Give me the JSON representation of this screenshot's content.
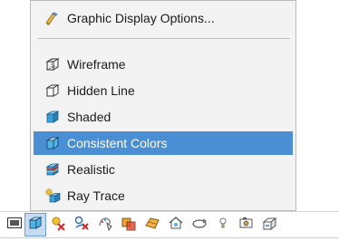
{
  "menu": {
    "items": [
      {
        "label": "Graphic Display Options...",
        "icon": "graphic-options-icon"
      },
      {
        "label": "Wireframe",
        "icon": "wireframe-cube-icon"
      },
      {
        "label": "Hidden Line",
        "icon": "hidden-line-cube-icon"
      },
      {
        "label": "Shaded",
        "icon": "shaded-cube-icon"
      },
      {
        "label": "Consistent Colors",
        "icon": "consistent-colors-cube-icon",
        "selected": true
      },
      {
        "label": "Realistic",
        "icon": "realistic-cube-icon"
      },
      {
        "label": "Ray Trace",
        "icon": "ray-trace-icon"
      }
    ]
  },
  "toolbar": {
    "buttons": [
      "display-mode-icon",
      "consistent-colors-cube-icon",
      "clear-object-icon",
      "clear-all-icon",
      "color-picker-icon",
      "transparency-icon",
      "surface-icon",
      "home-view-icon",
      "orbit-icon",
      "light-bulb-icon",
      "camera-icon",
      "section-icon"
    ]
  },
  "colors": {
    "selection": "#4a8ed3",
    "menu_bg": "#f3f3f3",
    "cube_blue": "#3a9fd6"
  }
}
